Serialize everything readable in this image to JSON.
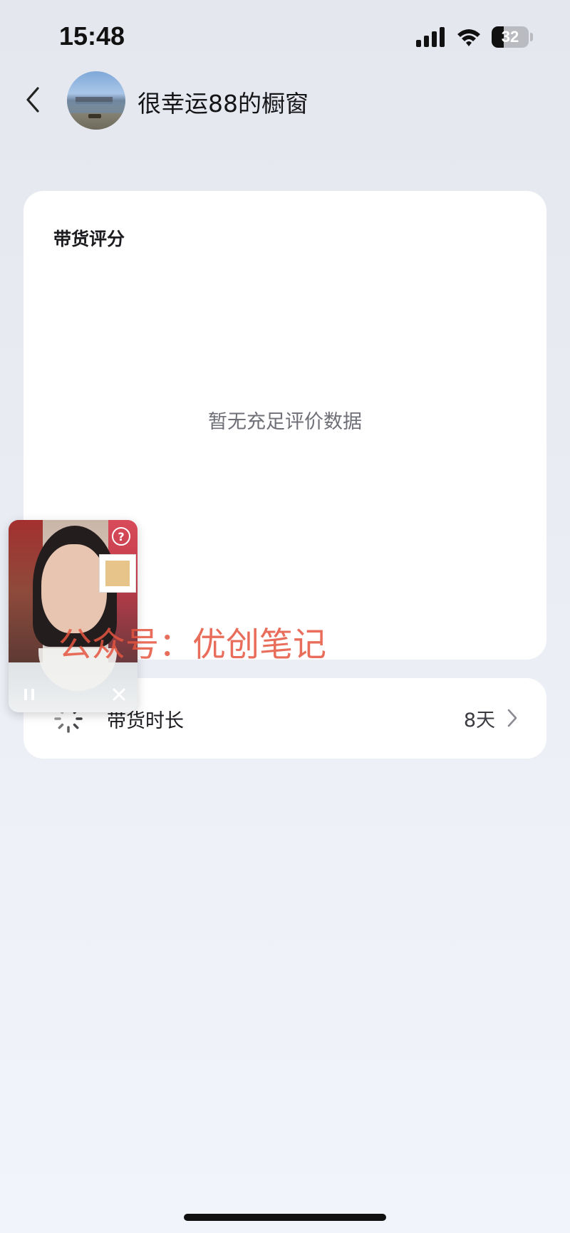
{
  "status_bar": {
    "time": "15:48",
    "battery_level": "32",
    "signal_icon": "cellular-signal-icon",
    "wifi_icon": "wifi-icon"
  },
  "header": {
    "back_icon": "chevron-left-icon",
    "title": "很幸运88的橱窗"
  },
  "score_card": {
    "title": "带货评分",
    "empty_message": "暂无充足评价数据"
  },
  "duration_card": {
    "icon": "loading-spinner-icon",
    "label": "带货时长",
    "value": "8天",
    "chevron_icon": "chevron-right-icon"
  },
  "pip_player": {
    "help_icon_text": "?",
    "pause_icon": "pause-icon",
    "close_icon": "close-icon"
  },
  "watermark": "公众号：优创笔记",
  "colors": {
    "watermark": "#e5553f",
    "card_background": "#ffffff",
    "page_background": "#e9ecf3"
  }
}
